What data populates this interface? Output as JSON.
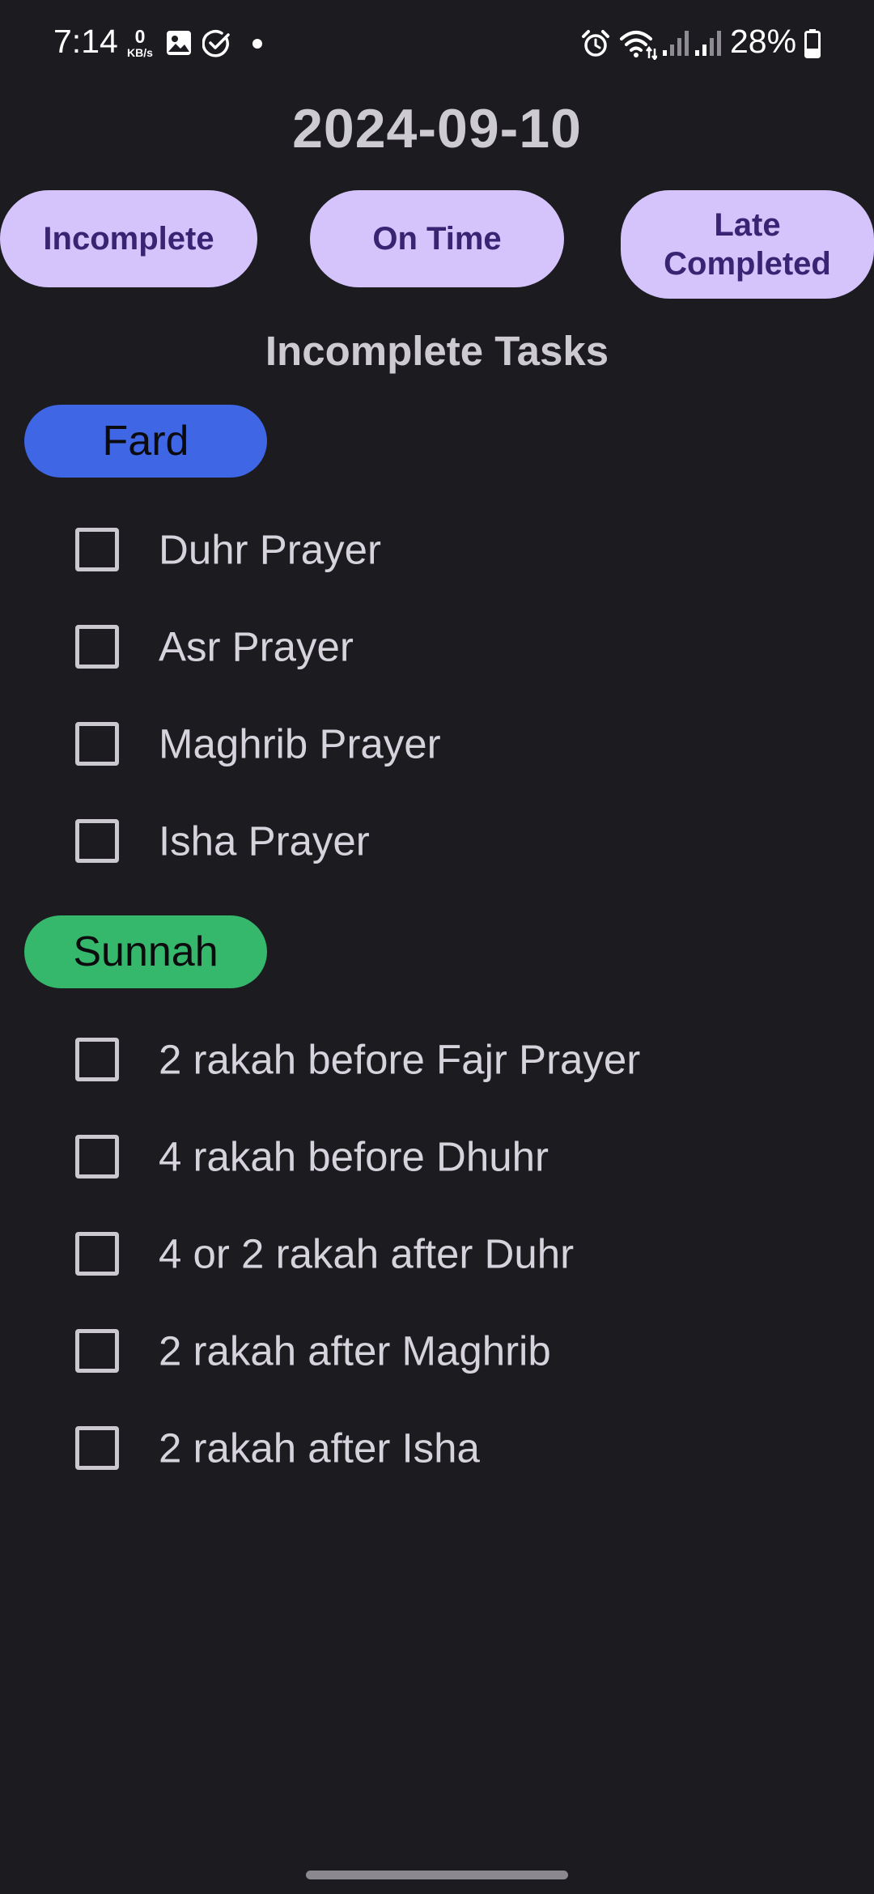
{
  "status_bar": {
    "time": "7:14",
    "net_speed_value": "0",
    "net_speed_unit": "KB/s",
    "battery_percent": "28%",
    "icons": [
      "gallery-icon",
      "check-circle-icon",
      "notification-dot-icon",
      "alarm-icon",
      "wifi-icon",
      "signal-icon",
      "signal-icon",
      "battery-icon"
    ]
  },
  "header": {
    "date": "2024-09-10"
  },
  "filters": {
    "incomplete": "Incomplete",
    "on_time": "On Time",
    "late_line1": "Late",
    "late_line2": "Completed"
  },
  "section_title": "Incomplete Tasks",
  "groups": {
    "fard": {
      "label": "Fard",
      "color": "#3f66e4",
      "tasks": [
        "Duhr Prayer",
        "Asr Prayer",
        "Maghrib Prayer",
        "Isha Prayer"
      ]
    },
    "sunnah": {
      "label": "Sunnah",
      "color": "#36b86c",
      "tasks": [
        "2 rakah before Fajr Prayer",
        "4 rakah before Dhuhr",
        "4 or 2 rakah after Duhr",
        "2 rakah after Maghrib",
        "2 rakah after Isha"
      ]
    }
  },
  "colors": {
    "background": "#1c1b20",
    "filter_button": "#d4c4fb",
    "filter_text": "#3a2373"
  }
}
